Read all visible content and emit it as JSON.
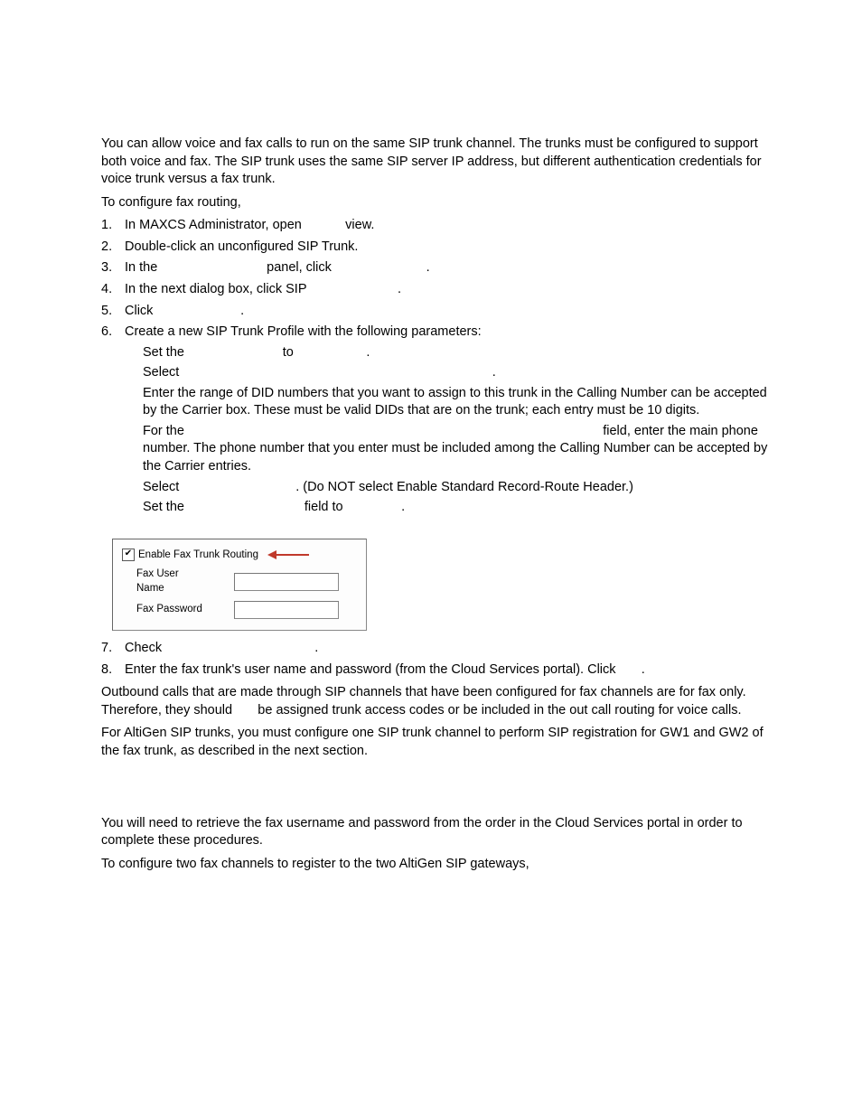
{
  "intro": "You can allow voice and fax calls to run on the same SIP trunk channel. The trunks must be configured to support both voice and fax. The SIP trunk uses the same SIP server IP address, but different authentication credentials for voice trunk versus a fax trunk.",
  "lead": "To configure fax routing,",
  "steps": {
    "s1": "In MAXCS Administrator, open            view.",
    "s2": "Double-click an unconfigured SIP Trunk.",
    "s3": "In the                              panel, click                          .",
    "s4": "In the next dialog box, click SIP                         .",
    "s5": "Click                        .",
    "s6": "Create a new SIP Trunk Profile with the following parameters:",
    "s7": "Check                                          .",
    "s8": "Enter the fax trunk's user name and password (from the Cloud Services portal). Click       ."
  },
  "subs": {
    "a": "Set the                           to                    .",
    "b": "Select                                                                                      .",
    "c": "Enter the range of DID numbers that you want to assign to this trunk in the Calling Number can be accepted by the Carrier box. These must be valid DIDs that are on the trunk; each entry must be 10 digits.",
    "d": "For the                                                                                                                   field, enter the main phone number. The phone number that you enter must be included among the Calling Number can be accepted by the Carrier entries.",
    "e": "Select                                . (Do NOT select Enable Standard Record-Route Header.)",
    "f": "Set the                                 field to                ."
  },
  "figure": {
    "checkbox_label": "Enable Fax Trunk Routing",
    "fax_user": "Fax User Name",
    "fax_pass": "Fax Password"
  },
  "after1": "Outbound calls that are made through SIP channels that have been configured for fax channels are for fax only. Therefore, they should       be assigned trunk access codes or be included in the out call routing for voice calls.",
  "after2": "For AltiGen SIP trunks, you must configure one SIP trunk channel to perform SIP registration for GW1 and GW2 of the fax trunk, as described in the next section.",
  "tail1": "You will need to retrieve the fax username and password from the order in the Cloud Services portal in order to complete these procedures.",
  "tail2": "To configure two fax channels to register to the two AltiGen SIP gateways,"
}
